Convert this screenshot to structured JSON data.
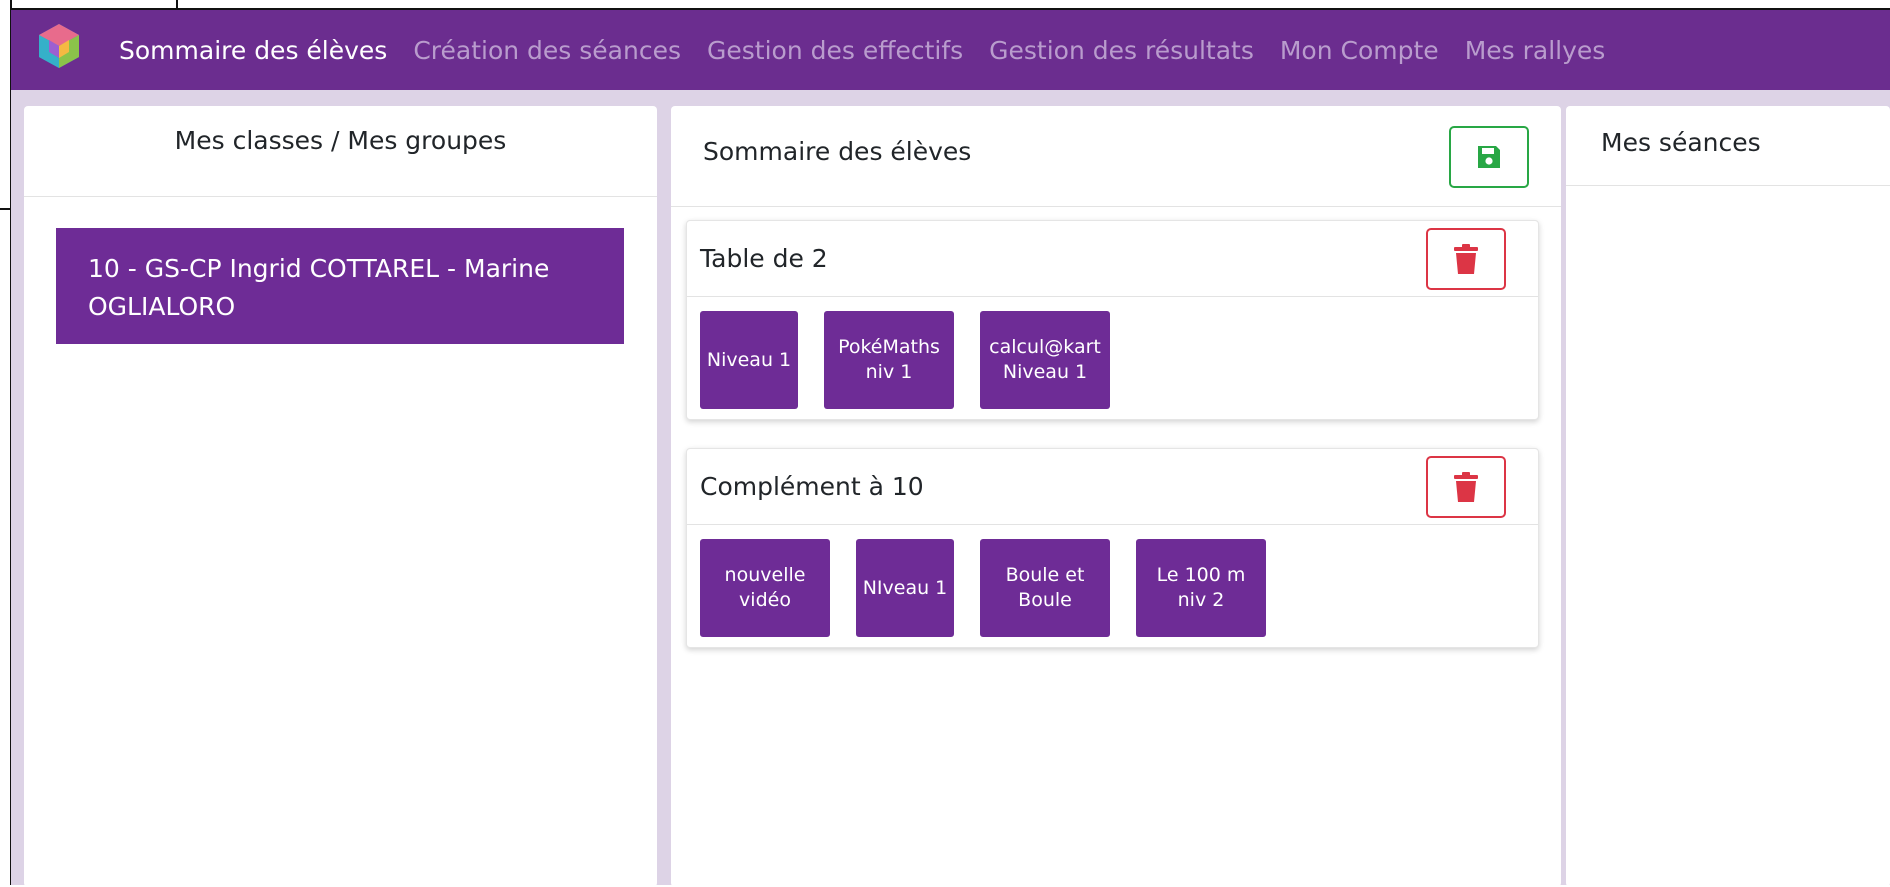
{
  "nav": {
    "items": [
      {
        "label": "Sommaire des élèves",
        "active": true
      },
      {
        "label": "Création des séances",
        "active": false
      },
      {
        "label": "Gestion des effectifs",
        "active": false
      },
      {
        "label": "Gestion des résultats",
        "active": false
      },
      {
        "label": "Mon Compte",
        "active": false
      },
      {
        "label": "Mes rallyes",
        "active": false
      }
    ]
  },
  "left_panel": {
    "title": "Mes classes / Mes groupes",
    "class_item": "10 - GS-CP Ingrid COTTAREL - Marine OGLIALORO"
  },
  "middle_panel": {
    "title": "Sommaire des élèves",
    "save_icon": "floppy-disk-icon",
    "cards": [
      {
        "title": "Table de 2",
        "delete_icon": "trash-icon",
        "tiles": [
          {
            "label": "Niveau 1"
          },
          {
            "label": "PokéMaths niv 1"
          },
          {
            "label": "calcul@kart Niveau 1"
          }
        ]
      },
      {
        "title": "Complément à 10",
        "delete_icon": "trash-icon",
        "tiles": [
          {
            "label": "nouvelle vidéo"
          },
          {
            "label": "NIveau 1"
          },
          {
            "label": "Boule et Boule"
          },
          {
            "label": "Le 100 m niv 2"
          }
        ]
      }
    ]
  },
  "right_panel": {
    "title": "Mes séances"
  },
  "colors": {
    "brand_purple": "#6b2d8f",
    "tile_purple": "#6e2c96",
    "save_green": "#28a745",
    "delete_red": "#dc3545",
    "background": "#ddd3e6"
  }
}
